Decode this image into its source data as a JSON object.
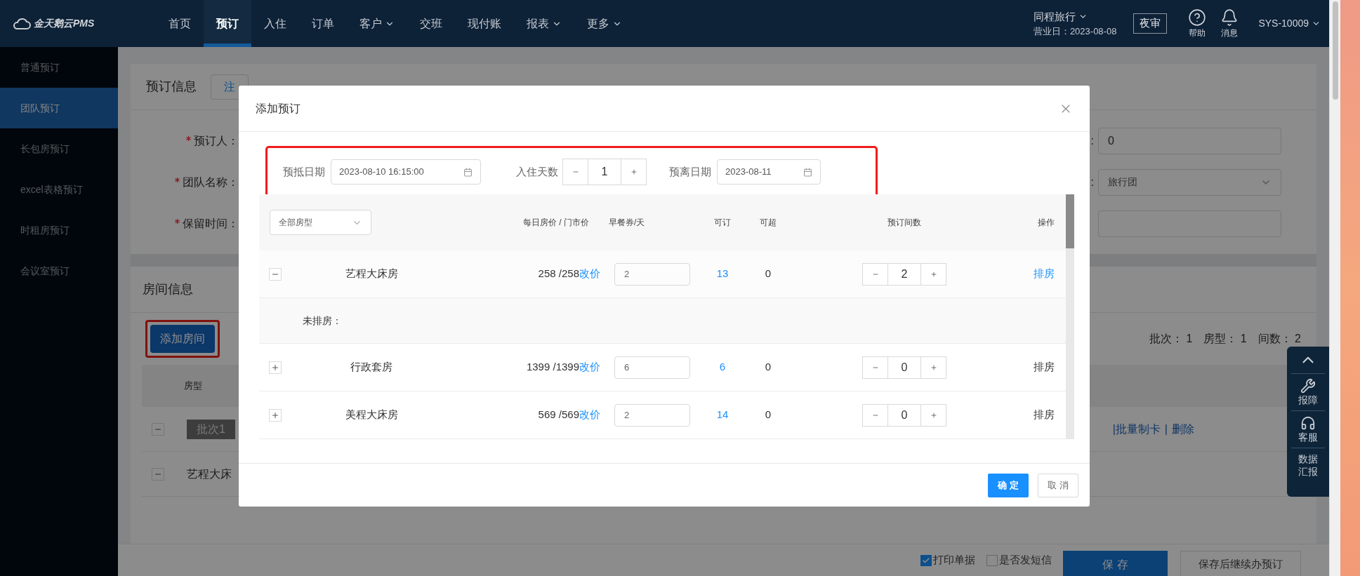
{
  "app": {
    "logo": "金天鹅云PMS"
  },
  "nav": [
    {
      "label": "首页",
      "selected": false,
      "dropdown": false
    },
    {
      "label": "预订",
      "selected": true,
      "dropdown": false
    },
    {
      "label": "入住",
      "selected": false,
      "dropdown": false
    },
    {
      "label": "订单",
      "selected": false,
      "dropdown": false
    },
    {
      "label": "客户",
      "selected": false,
      "dropdown": true
    },
    {
      "label": "交班",
      "selected": false,
      "dropdown": false
    },
    {
      "label": "现付账",
      "selected": false,
      "dropdown": false
    },
    {
      "label": "报表",
      "selected": false,
      "dropdown": true
    },
    {
      "label": "更多",
      "selected": false,
      "dropdown": true
    }
  ],
  "hotel": {
    "name": "同程旅行",
    "business_day": "营业日：2023-08-08"
  },
  "night_audit": "夜审",
  "toolbar": [
    {
      "kind": "help",
      "label": "帮助"
    },
    {
      "kind": "bell",
      "label": "消息"
    }
  ],
  "user": "SYS-10009",
  "sidebar": [
    {
      "label": "普通预订",
      "selected": false
    },
    {
      "label": "团队预订",
      "selected": true
    },
    {
      "label": "长包房预订",
      "selected": false
    },
    {
      "label": "excel表格预订",
      "selected": false
    },
    {
      "label": "时租房预订",
      "selected": false
    },
    {
      "label": "会议室预订",
      "selected": false
    }
  ],
  "booking_info": {
    "title": "预订信息",
    "member_button": "注",
    "fields": [
      {
        "label": "预订人：",
        "required": true,
        "right": {
          "kind": "input",
          "label": ":",
          "value": "0"
        }
      },
      {
        "label": "团队名称：",
        "required": true,
        "right": {
          "kind": "select",
          "label": ":",
          "value": "旅行团"
        }
      },
      {
        "label": "保留时间：",
        "required": true,
        "right": {
          "kind": "input"
        }
      }
    ]
  },
  "room_info": {
    "title": "房间信息",
    "add_button": "添加房间",
    "stats": [
      {
        "label": "批次：",
        "value": "1"
      },
      {
        "label": "房型：",
        "value": "1"
      },
      {
        "label": "间数：",
        "value": "2"
      }
    ],
    "columns": [
      "房型"
    ],
    "rows": [
      {
        "kind": "batch",
        "expanded": true,
        "label": "批次1",
        "actions": [
          "|批量制卡",
          "|",
          "删除"
        ]
      },
      {
        "kind": "room",
        "expanded": true,
        "label": "艺程大床"
      }
    ]
  },
  "bottom_bar": {
    "options": [
      {
        "label": "打印单据",
        "checked": true
      },
      {
        "label": "是否发短信",
        "checked": false
      }
    ],
    "save": "保 存",
    "save_continue": "保存后继续办预订"
  },
  "float_tools": [
    {
      "kind": "up"
    },
    {
      "kind": "wrench",
      "label": "报障"
    },
    {
      "kind": "headset",
      "label": "客服"
    },
    {
      "kind": "text",
      "label": "数据汇报"
    }
  ],
  "modal": {
    "title": "添加预订",
    "arrival": {
      "label": "预抵日期",
      "value": "2023-08-10 16:15:00"
    },
    "nights": {
      "label": "入住天数",
      "value": "1"
    },
    "departure": {
      "label": "预离日期",
      "value": "2023-08-11"
    },
    "room_filter": "全部房型",
    "columns": [
      "每日房价 / 门市价",
      "早餐券/天",
      "可订",
      "可超",
      "预订间数",
      "操作"
    ],
    "rows": [
      {
        "kind": "room",
        "expanded": true,
        "name": "艺程大床房",
        "price": "258 /258",
        "price_link": "改价",
        "breakfast": "2",
        "available": "13",
        "over": "0",
        "count": "2",
        "action": "排房",
        "active": true
      },
      {
        "kind": "unassigned",
        "label": "未排房："
      },
      {
        "kind": "room",
        "expanded": false,
        "name": "行政套房",
        "price": "1399 /1399",
        "price_link": "改价",
        "breakfast": "6",
        "available": "6",
        "over": "0",
        "count": "0",
        "action": "排房",
        "active": false
      },
      {
        "kind": "room",
        "expanded": false,
        "name": "美程大床房",
        "price": "569 /569",
        "price_link": "改价",
        "breakfast": "2",
        "available": "14",
        "over": "0",
        "count": "0",
        "action": "排房",
        "active": false
      }
    ],
    "ok": "确 定",
    "cancel": "取 消"
  }
}
